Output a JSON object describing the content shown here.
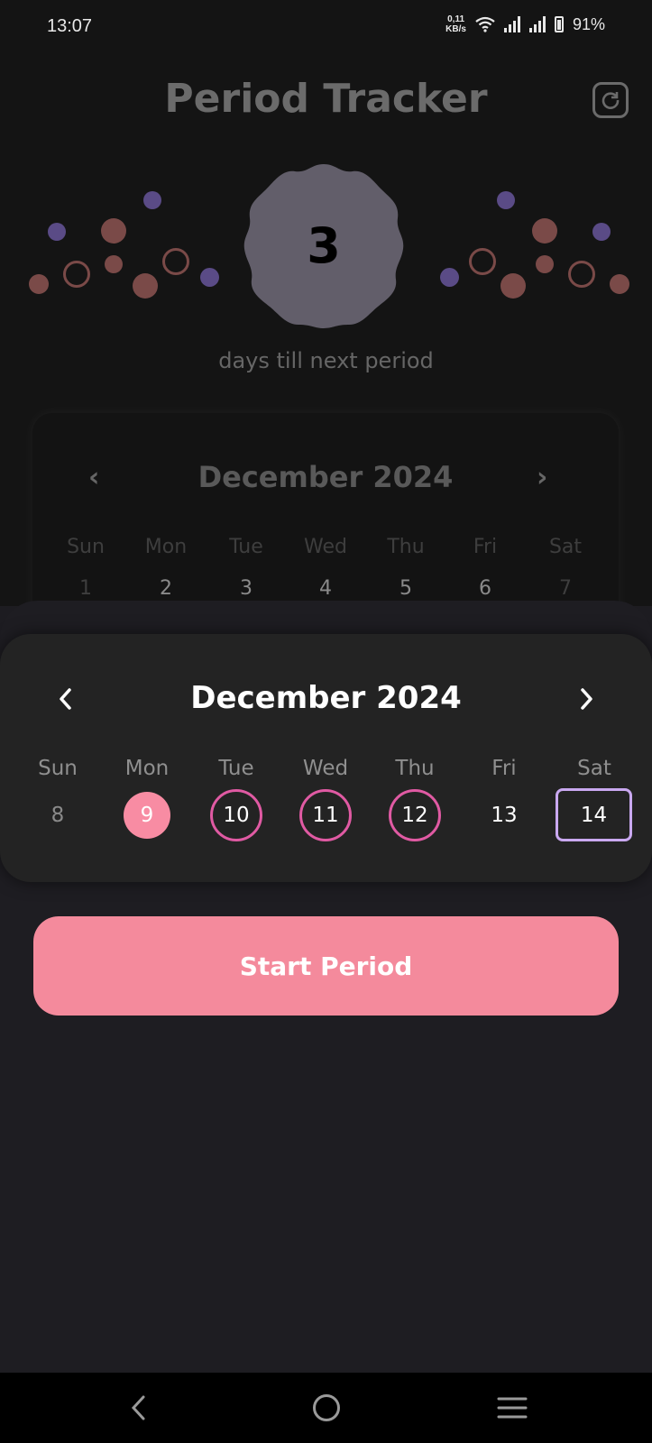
{
  "status_bar": {
    "time": "13:07",
    "net_speed_value": "0,11",
    "net_speed_unit": "KB/s",
    "battery": "91%"
  },
  "app": {
    "title": "Period Tracker",
    "days_until": "3",
    "days_caption": "days till next period"
  },
  "background_calendar": {
    "month": "December 2024",
    "weekdays": [
      "Sun",
      "Mon",
      "Tue",
      "Wed",
      "Thu",
      "Fri",
      "Sat"
    ],
    "days": [
      "1",
      "2",
      "3",
      "4",
      "5",
      "6",
      "7"
    ]
  },
  "week_picker": {
    "month": "December 2024",
    "prev_icon": "chevron-left-icon",
    "next_icon": "chevron-right-icon",
    "weekdays": [
      "Sun",
      "Mon",
      "Tue",
      "Wed",
      "Thu",
      "Fri",
      "Sat"
    ],
    "days": [
      {
        "label": "8",
        "state": "muted"
      },
      {
        "label": "9",
        "state": "period-start"
      },
      {
        "label": "10",
        "state": "predicted"
      },
      {
        "label": "11",
        "state": "predicted"
      },
      {
        "label": "12",
        "state": "predicted"
      },
      {
        "label": "13",
        "state": "normal"
      },
      {
        "label": "14",
        "state": "today"
      }
    ]
  },
  "actions": {
    "start_period": "Start Period"
  },
  "colors": {
    "accent_pink": "#f48a9c",
    "ring_pink": "#e05aa3",
    "today_lavender": "#c9a8f0",
    "background": "#1d1c21"
  }
}
